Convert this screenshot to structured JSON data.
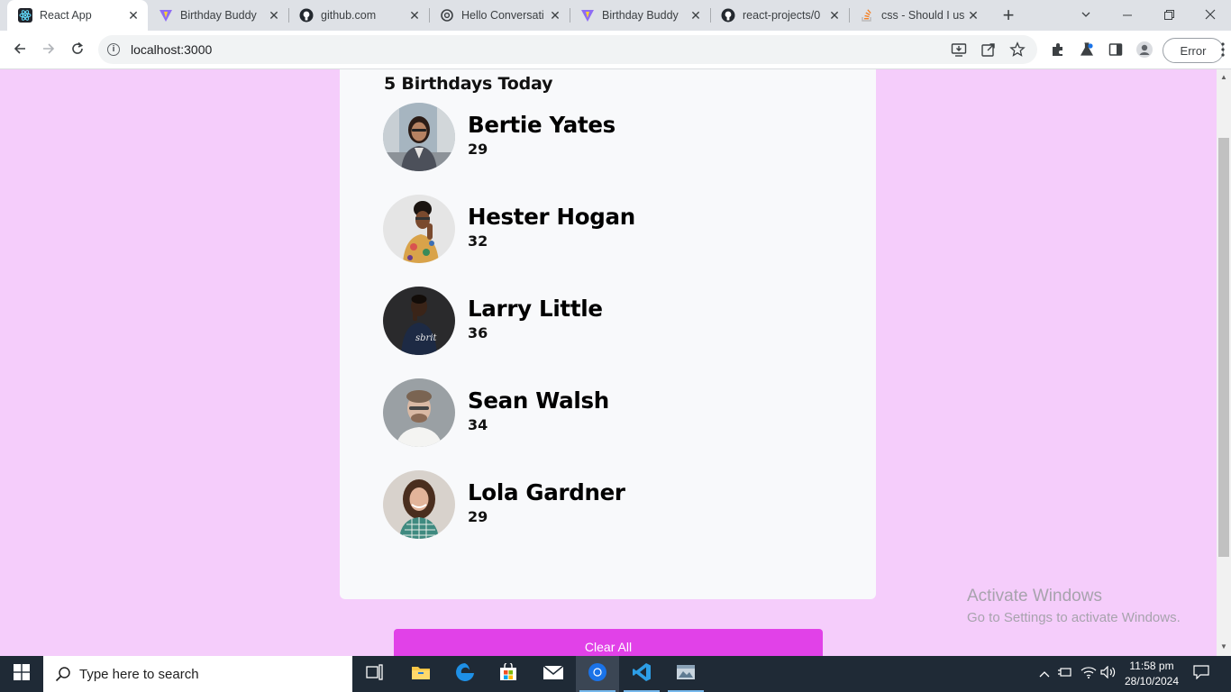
{
  "browser": {
    "tabs": [
      {
        "title": "React App",
        "favicon": "react-icon",
        "active": true
      },
      {
        "title": "Birthday Buddy",
        "favicon": "vite-icon",
        "active": false
      },
      {
        "title": "github.com",
        "favicon": "github-icon",
        "active": false
      },
      {
        "title": "Hello Conversati",
        "favicon": "openai-icon",
        "active": false
      },
      {
        "title": "Birthday Buddy",
        "favicon": "vite-icon",
        "active": false
      },
      {
        "title": "react-projects/0",
        "favicon": "github-icon",
        "active": false
      },
      {
        "title": "css - Should I us",
        "favicon": "stackoverflow-icon",
        "active": false
      }
    ],
    "address": "localhost:3000",
    "profile_status": "Error"
  },
  "page": {
    "heading": "5 Birthdays Today",
    "people": [
      {
        "name": "Bertie Yates",
        "age": "29"
      },
      {
        "name": "Hester Hogan",
        "age": "32"
      },
      {
        "name": "Larry Little",
        "age": "36"
      },
      {
        "name": "Sean Walsh",
        "age": "34"
      },
      {
        "name": "Lola Gardner",
        "age": "29"
      }
    ],
    "clear_label": "Clear All",
    "colors": {
      "background": "#f5cdfb",
      "card": "#f8f9fb",
      "button": "#e141e8"
    }
  },
  "watermark": {
    "line1": "Activate Windows",
    "line2": "Go to Settings to activate Windows."
  },
  "taskbar": {
    "search_placeholder": "Type here to search",
    "time": "11:58 pm",
    "date": "28/10/2024"
  }
}
